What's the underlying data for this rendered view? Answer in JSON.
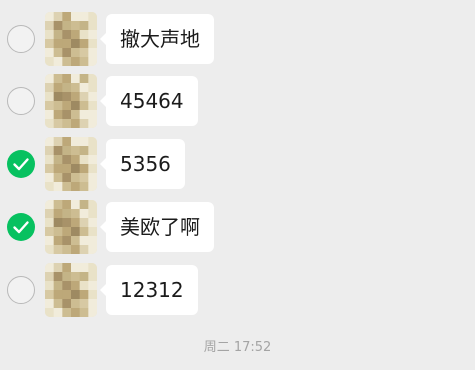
{
  "colors": {
    "background": "#ededed",
    "bubble": "#ffffff",
    "check_green": "#07c160",
    "circle_border": "#b9b9b9",
    "timestamp_text": "#a4a4a4"
  },
  "messages": [
    {
      "text": "撤大声地",
      "selected": false,
      "avatar_icon": "pixelated-avatar",
      "check_icon": "unchecked-circle-icon"
    },
    {
      "text": "45464",
      "selected": false,
      "avatar_icon": "pixelated-avatar",
      "check_icon": "unchecked-circle-icon"
    },
    {
      "text": "5356",
      "selected": true,
      "avatar_icon": "pixelated-avatar",
      "check_icon": "check-icon"
    },
    {
      "text": "美欧了啊",
      "selected": true,
      "avatar_icon": "pixelated-avatar",
      "check_icon": "check-icon"
    },
    {
      "text": "12312",
      "selected": false,
      "avatar_icon": "pixelated-avatar",
      "check_icon": "unchecked-circle-icon"
    }
  ],
  "timestamp": "周二 17:52"
}
